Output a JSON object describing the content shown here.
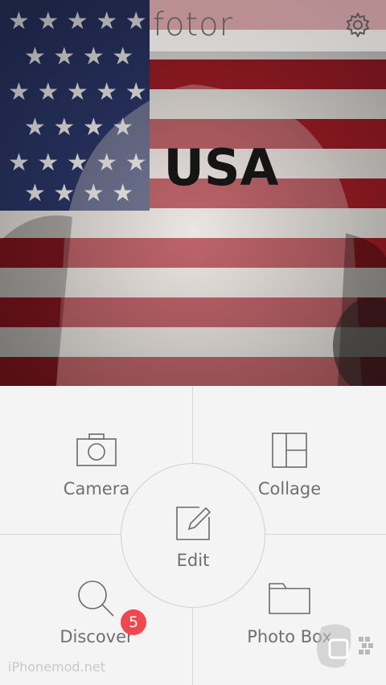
{
  "header": {
    "logo_text": "fotor",
    "settings_icon": "gear-icon"
  },
  "hero": {
    "shirt_text": "USA"
  },
  "menu": {
    "camera": {
      "label": "Camera",
      "icon": "camera-icon"
    },
    "collage": {
      "label": "Collage",
      "icon": "collage-grid-icon"
    },
    "edit": {
      "label": "Edit",
      "icon": "edit-pencil-icon"
    },
    "discover": {
      "label": "Discover",
      "icon": "search-icon",
      "badge_count": "5"
    },
    "photo_box": {
      "label": "Photo Box",
      "icon": "folder-icon"
    }
  },
  "watermark": {
    "text": "iPhonemod.net"
  },
  "colors": {
    "badge": "#f2474f",
    "label": "#6f6f6f",
    "flag_red": "#a01b24",
    "flag_blue": "#2b3768"
  }
}
